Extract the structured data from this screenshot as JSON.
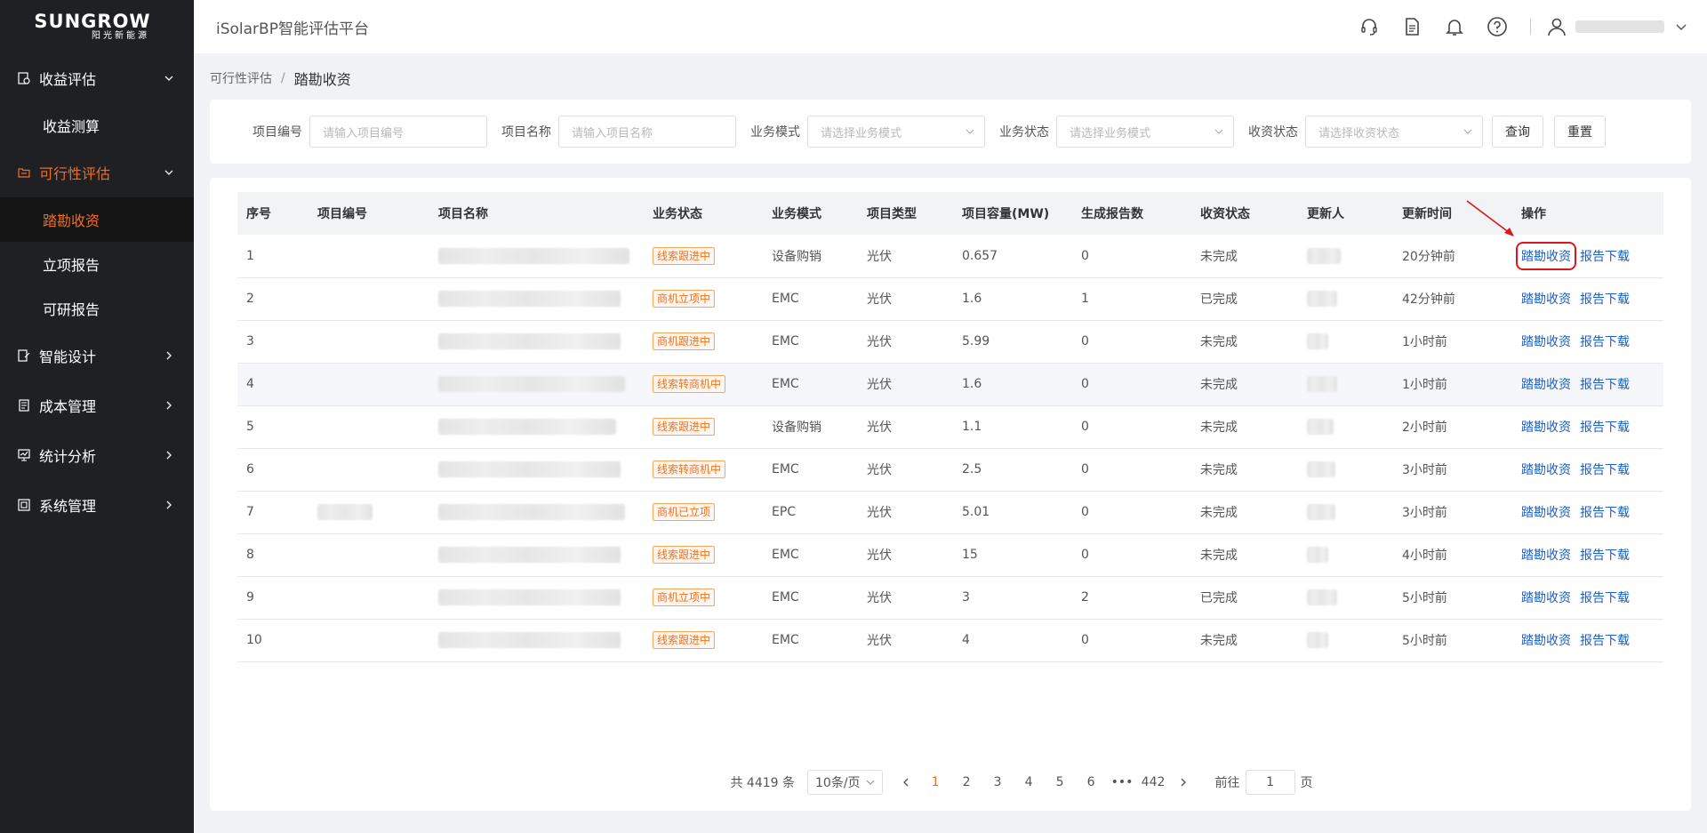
{
  "brand": {
    "logo_main": "SUNGROW",
    "logo_sub": "阳光新能源"
  },
  "sidebar": {
    "groups": [
      {
        "label": "收益评估",
        "icon": "revenue-icon",
        "expanded": true,
        "children": [
          "收益测算"
        ]
      },
      {
        "label": "可行性评估",
        "icon": "folder-icon",
        "expanded": true,
        "active": true,
        "children": [
          "踏勘收资",
          "立项报告",
          "可研报告"
        ]
      },
      {
        "label": "智能设计",
        "icon": "design-icon"
      },
      {
        "label": "成本管理",
        "icon": "cost-icon"
      },
      {
        "label": "统计分析",
        "icon": "stats-icon"
      },
      {
        "label": "系统管理",
        "icon": "system-icon"
      }
    ],
    "selected": "踏勘收资"
  },
  "header": {
    "title": "iSolarBP智能评估平台",
    "icons": [
      "headset-icon",
      "document-icon",
      "bell-icon",
      "help-icon",
      "user-icon",
      "chevron-down-icon"
    ]
  },
  "breadcrumb": {
    "parent": "可行性评估",
    "separator": "/",
    "current": "踏勘收资"
  },
  "filters": {
    "project_no": {
      "label": "项目编号",
      "placeholder": "请输入项目编号"
    },
    "project_name": {
      "label": "项目名称",
      "placeholder": "请输入项目名称"
    },
    "biz_mode": {
      "label": "业务模式",
      "placeholder": "请选择业务模式"
    },
    "biz_status": {
      "label": "业务状态",
      "placeholder": "请选择业务模式"
    },
    "collect_status": {
      "label": "收资状态",
      "placeholder": "请选择收资状态"
    },
    "query_btn": "查询",
    "reset_btn": "重置"
  },
  "table": {
    "headers": [
      "序号",
      "项目编号",
      "项目名称",
      "业务状态",
      "业务模式",
      "项目类型",
      "项目容量(MW)",
      "生成报告数",
      "收资状态",
      "更新人",
      "更新时间",
      "操作"
    ],
    "op_survey": "踏勘收资",
    "op_download": "报告下载",
    "rows": [
      {
        "no": "1",
        "status": "线索跟进中",
        "mode": "设备购销",
        "type": "光伏",
        "cap": "0.657",
        "reports": "0",
        "collect": "未完成",
        "time": "20分钟前"
      },
      {
        "no": "2",
        "status": "商机立项中",
        "mode": "EMC",
        "type": "光伏",
        "cap": "1.6",
        "reports": "1",
        "collect": "已完成",
        "time": "42分钟前"
      },
      {
        "no": "3",
        "status": "商机跟进中",
        "mode": "EMC",
        "type": "光伏",
        "cap": "5.99",
        "reports": "0",
        "collect": "未完成",
        "time": "1小时前"
      },
      {
        "no": "4",
        "status": "线索转商机中",
        "mode": "EMC",
        "type": "光伏",
        "cap": "1.6",
        "reports": "0",
        "collect": "未完成",
        "time": "1小时前"
      },
      {
        "no": "5",
        "status": "线索跟进中",
        "mode": "设备购销",
        "type": "光伏",
        "cap": "1.1",
        "reports": "0",
        "collect": "未完成",
        "time": "2小时前"
      },
      {
        "no": "6",
        "status": "线索转商机中",
        "mode": "EMC",
        "type": "光伏",
        "cap": "2.5",
        "reports": "0",
        "collect": "未完成",
        "time": "3小时前"
      },
      {
        "no": "7",
        "status": "商机已立项",
        "mode": "EPC",
        "type": "光伏",
        "cap": "5.01",
        "reports": "0",
        "collect": "未完成",
        "time": "3小时前"
      },
      {
        "no": "8",
        "status": "线索跟进中",
        "mode": "EMC",
        "type": "光伏",
        "cap": "15",
        "reports": "0",
        "collect": "未完成",
        "time": "4小时前"
      },
      {
        "no": "9",
        "status": "商机立项中",
        "mode": "EMC",
        "type": "光伏",
        "cap": "3",
        "reports": "2",
        "collect": "已完成",
        "time": "5小时前"
      },
      {
        "no": "10",
        "status": "线索跟进中",
        "mode": "EMC",
        "type": "光伏",
        "cap": "4",
        "reports": "0",
        "collect": "未完成",
        "time": "5小时前"
      }
    ]
  },
  "pagination": {
    "total": "共 4419 条",
    "page_size": "10条/页",
    "pages": [
      "1",
      "2",
      "3",
      "4",
      "5",
      "6",
      "•••",
      "442"
    ],
    "current": "1",
    "goto_label": "前往",
    "goto_value": "1",
    "goto_suffix": "页"
  },
  "colors": {
    "accent": "#f26d21",
    "link": "#1e5fbf",
    "sidebar_bg": "#1f2024",
    "annotation": "#e0151c"
  }
}
